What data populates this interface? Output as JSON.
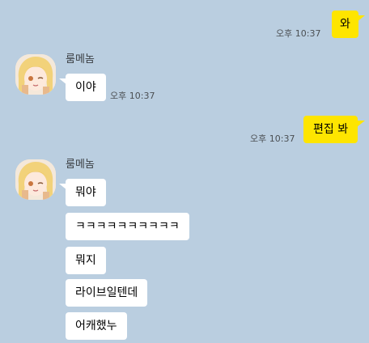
{
  "chat": {
    "messages": [
      {
        "type": "mine",
        "text": "와",
        "time": "오후 10:37"
      },
      {
        "type": "theirs",
        "sender": "룸메놈",
        "text": "이야",
        "time": "오후 10:37"
      },
      {
        "type": "mine",
        "text": "편집 봐",
        "time": "오후 10:37"
      },
      {
        "type": "theirs",
        "sender": "룸메놈",
        "lines": [
          "뭐야",
          "ㅋㅋㅋㅋㅋㅋㅋㅋㅋㅋ",
          "뭐지",
          "라이브일텐데",
          "어캐했누"
        ]
      }
    ]
  },
  "colors": {
    "background": "#bacee0",
    "my_bubble": "#fee500",
    "their_bubble": "#ffffff"
  },
  "icons": {
    "avatar": "profile-avatar-anime-girl"
  }
}
